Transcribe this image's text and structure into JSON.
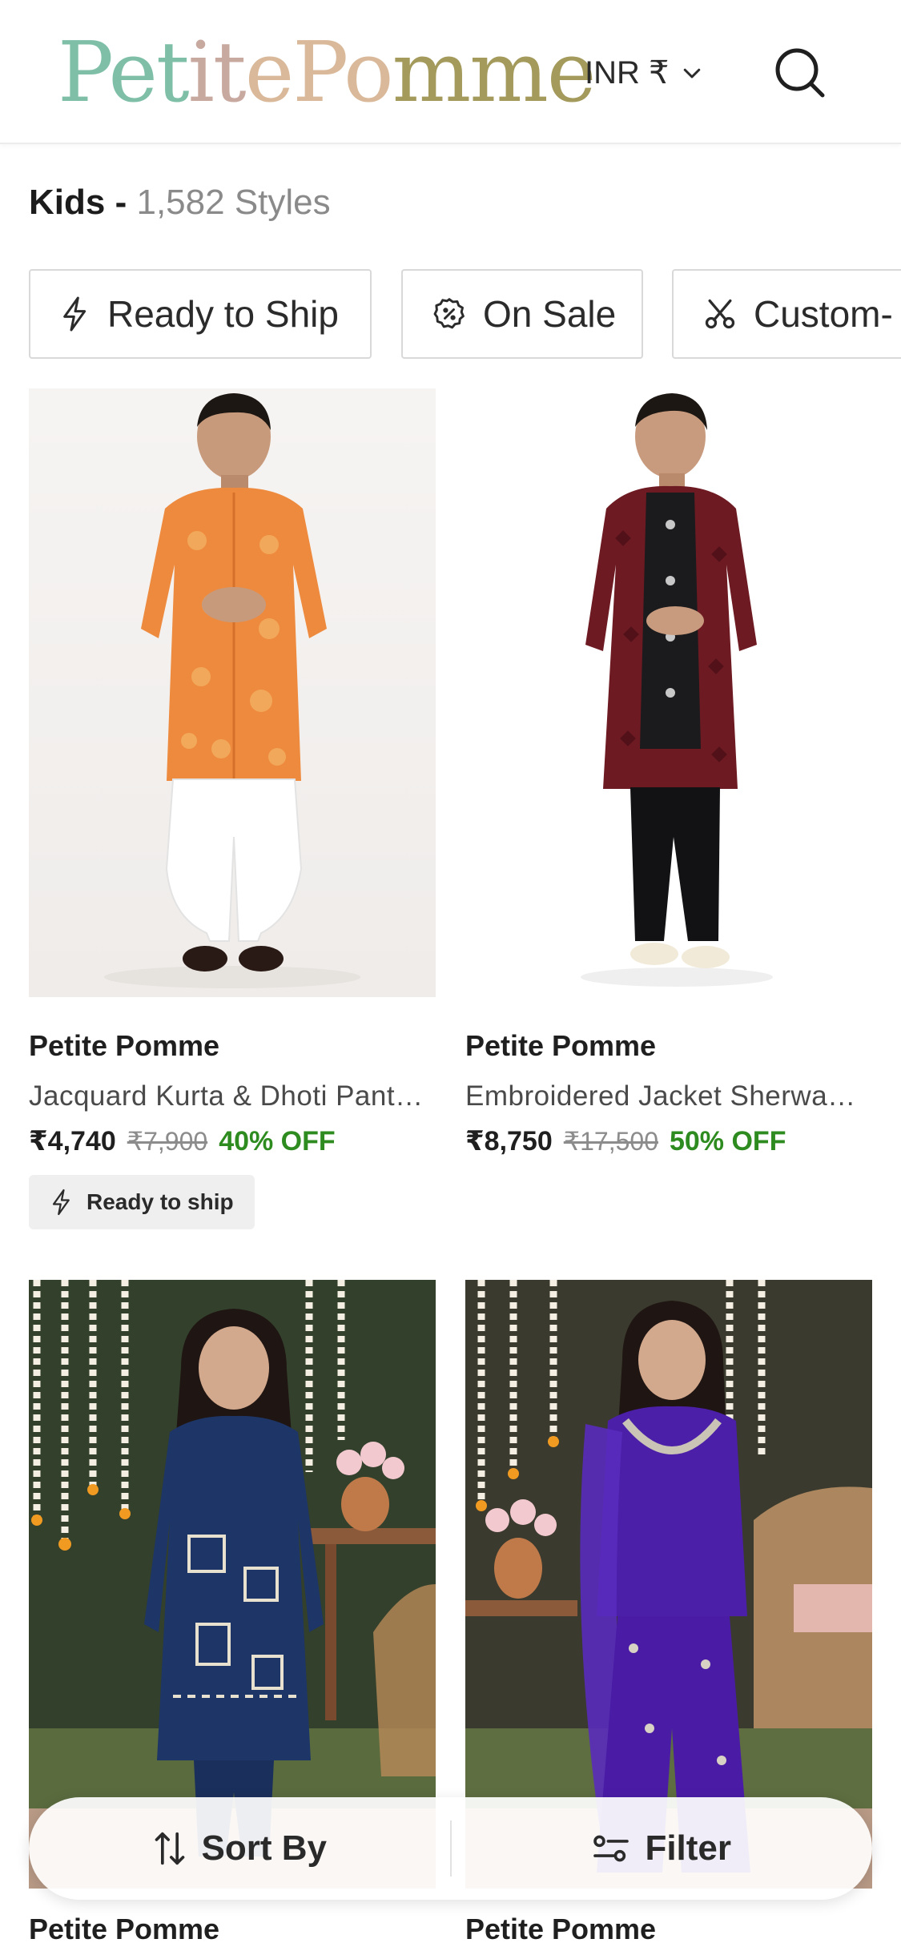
{
  "header": {
    "logo_text": "PetitePomme",
    "currency_label": "INR ₹",
    "colors": {
      "logo_gradient": [
        "#7fbfa8",
        "#c8a9a0",
        "#d9b99a",
        "#a39a5c"
      ]
    },
    "icons": {
      "currency_dropdown": "chevron-down-icon",
      "search": "search-icon"
    }
  },
  "page": {
    "category": "Kids",
    "separator": "-",
    "count_text": "1,582 Styles"
  },
  "filters": [
    {
      "label": "Ready to Ship",
      "icon": "lightning-icon"
    },
    {
      "label": "On Sale",
      "icon": "discount-badge-icon"
    },
    {
      "label": "Custom-",
      "icon": "scissors-icon"
    }
  ],
  "products": [
    {
      "brand": "Petite Pomme",
      "name": "Jacquard Kurta & Dhoti Pant…",
      "price": "₹4,740",
      "mrp": "₹7,900",
      "discount": "40% OFF",
      "tag": "Ready to ship"
    },
    {
      "brand": "Petite Pomme",
      "name": "Embroidered Jacket Sherwa…",
      "price": "₹8,750",
      "mrp": "₹17,500",
      "discount": "50% OFF"
    },
    {
      "brand": "Petite Pomme"
    },
    {
      "brand": "Petite Pomme"
    }
  ],
  "bottom_bar": {
    "sort_label": "Sort By",
    "filter_label": "Filter"
  },
  "colors": {
    "discount_green": "#2e8b1f",
    "chip_border": "#d9d9d9",
    "tag_bg": "#efefef"
  }
}
